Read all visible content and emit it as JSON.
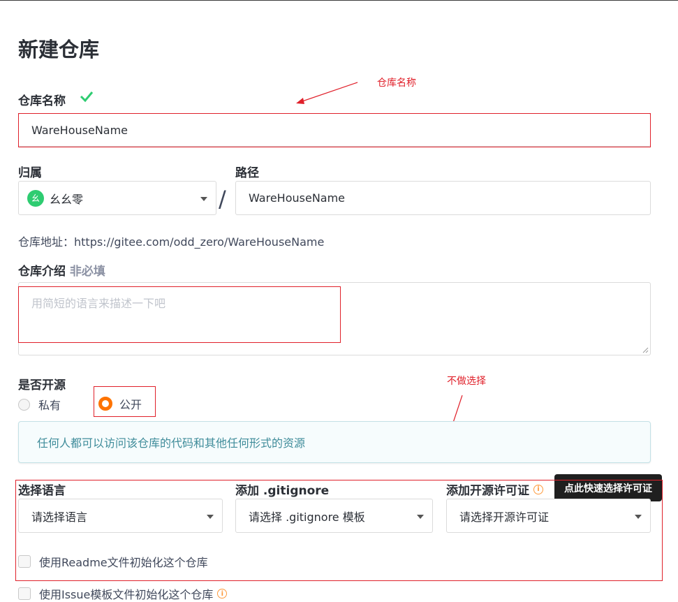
{
  "page": {
    "title": "新建仓库"
  },
  "repo_name": {
    "label": "仓库名称",
    "value": "WareHouseName"
  },
  "owner": {
    "label": "归属",
    "value": "幺幺零",
    "avatar_char": "幺"
  },
  "separator": "/",
  "path": {
    "label": "路径",
    "value": "WareHouseName"
  },
  "address": {
    "text": "仓库地址：https://gitee.com/odd_zero/WareHouseName"
  },
  "description": {
    "label": "仓库介绍",
    "optional": "非必填",
    "placeholder": "用简短的语言来描述一下吧"
  },
  "visibility": {
    "label": "是否开源",
    "options": [
      {
        "label": "私有",
        "selected": false
      },
      {
        "label": "公开",
        "selected": true
      }
    ],
    "notice": "任何人都可以访问该仓库的代码和其他任何形式的资源"
  },
  "language": {
    "label": "选择语言",
    "value": "请选择语言"
  },
  "gitignore": {
    "label": "添加 .gitignore",
    "value": "请选择 .gitignore 模板"
  },
  "license": {
    "label": "添加开源许可证",
    "value": "请选择开源许可证",
    "tooltip": "点此快速选择许可证"
  },
  "init_options": [
    {
      "label": "使用Readme文件初始化这个仓库",
      "checked": false
    },
    {
      "label": "使用Issue模板文件初始化这个仓库",
      "checked": false
    }
  ],
  "annotations": {
    "repo_name": "仓库名称",
    "no_select": "不做选择"
  },
  "colors": {
    "accent": "#fe7300",
    "annotation": "#e0202a",
    "check": "#2ecc71"
  }
}
